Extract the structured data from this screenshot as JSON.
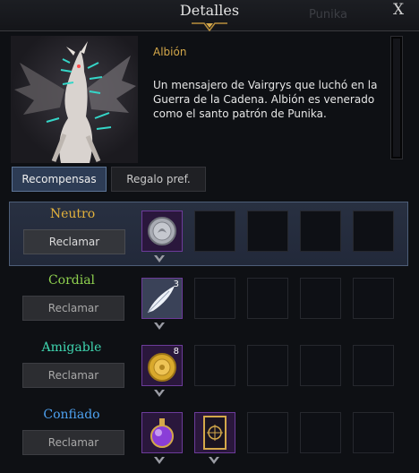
{
  "window": {
    "title": "Detalles",
    "ghost_text": "Punika",
    "close_label": "X"
  },
  "npc": {
    "name": "Albión",
    "description": "Un mensajero de Vairgrys que luchó en la Guerra de la Cadena. Albión es venerado como el santo patrón de Punika."
  },
  "tabs": [
    {
      "label": "Recompensas",
      "active": true
    },
    {
      "label": "Regalo pref.",
      "active": false
    }
  ],
  "tiers": [
    {
      "name": "Neutro",
      "color": "#e3b23c",
      "button": "Reclamar",
      "claimable": true,
      "rewards": [
        {
          "icon": "silver-coin-icon",
          "count": ""
        }
      ]
    },
    {
      "name": "Cordial",
      "color": "#8fd14f",
      "button": "Reclamar",
      "claimable": false,
      "rewards": [
        {
          "icon": "feather-icon",
          "count": "3"
        }
      ]
    },
    {
      "name": "Amigable",
      "color": "#3fd6b0",
      "button": "Reclamar",
      "claimable": false,
      "rewards": [
        {
          "icon": "gold-coin-icon",
          "count": "8"
        }
      ]
    },
    {
      "name": "Confiado",
      "color": "#4ea1f0",
      "button": "Reclamar",
      "claimable": false,
      "rewards": [
        {
          "icon": "potion-icon",
          "count": ""
        },
        {
          "icon": "card-icon",
          "count": ""
        }
      ]
    }
  ],
  "colors": {
    "accent_gold": "#d4a84a",
    "slot_filled_bg": "#2a173c"
  }
}
